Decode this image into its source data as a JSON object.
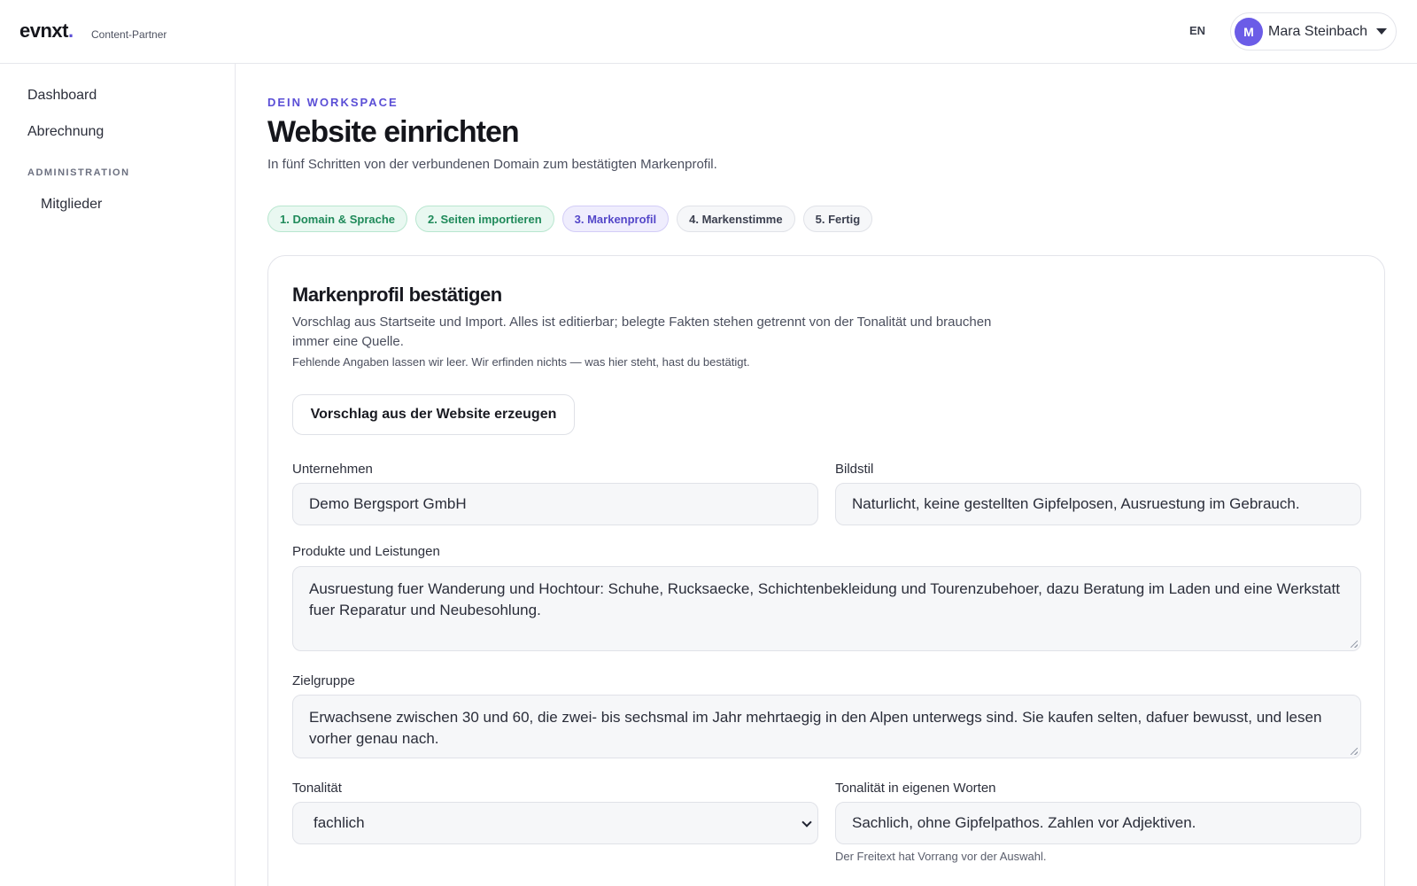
{
  "app": {
    "logo": "evnxt",
    "logo_dot": ".",
    "logo_sub": "Content-Partner",
    "lang": "EN",
    "user": {
      "initial": "M",
      "name": "Mara Steinbach"
    }
  },
  "sidebar": {
    "items": [
      {
        "label": "Dashboard"
      },
      {
        "label": "Abrechnung"
      }
    ],
    "section": "ADMINISTRATION",
    "sub_items": [
      {
        "label": "Mitglieder"
      }
    ]
  },
  "header": {
    "eyebrow": "DEIN WORKSPACE",
    "title": "Website einrichten",
    "subtitle": "In fünf Schritten von der verbundenen Domain zum bestätigten Markenprofil."
  },
  "steps": [
    {
      "label": "1. Domain & Sprache",
      "state": "done"
    },
    {
      "label": "2. Seiten importieren",
      "state": "done"
    },
    {
      "label": "3. Markenprofil",
      "state": "active"
    },
    {
      "label": "4. Markenstimme",
      "state": "pending"
    },
    {
      "label": "5. Fertig",
      "state": "pending"
    }
  ],
  "card": {
    "title": "Markenprofil bestätigen",
    "description": "Vorschlag aus Startseite und Import. Alles ist editierbar; belegte Fakten stehen getrennt von der Tonalität und brauchen immer eine Quelle.",
    "note": "Fehlende Angaben lassen wir leer. Wir erfinden nichts — was hier steht, hast du bestätigt.",
    "suggest_button": "Vorschlag aus der Website erzeugen",
    "fields": {
      "company": {
        "label": "Unternehmen",
        "value": "Demo Bergsport GmbH"
      },
      "image_style": {
        "label": "Bildstil",
        "value": "Naturlicht, keine gestellten Gipfelposen, Ausruestung im Gebrauch."
      },
      "products": {
        "label": "Produkte und Leistungen",
        "value": "Ausruestung fuer Wanderung und Hochtour: Schuhe, Rucksaecke, Schichtenbekleidung und Tourenzubehoer, dazu Beratung im Laden und eine Werkstatt fuer Reparatur und Neubesohlung."
      },
      "audience": {
        "label": "Zielgruppe",
        "value": "Erwachsene zwischen 30 und 60, die zwei- bis sechsmal im Jahr mehrtaegig in den Alpen unterwegs sind. Sie kaufen selten, dafuer bewusst, und lesen vorher genau nach."
      },
      "tone": {
        "label": "Tonalität",
        "value": "fachlich"
      },
      "tone_free": {
        "label": "Tonalität in eigenen Worten",
        "value": "Sachlich, ohne Gipfelpathos. Zahlen vor Adjektiven.",
        "hint": "Der Freitext hat Vorrang vor der Auswahl."
      }
    }
  },
  "colors": {
    "accent": "#5b4fd6",
    "done_bg": "#e9f8f1",
    "done_text": "#1f8a5a",
    "active_bg": "#efedfd",
    "active_text": "#5447c9"
  }
}
